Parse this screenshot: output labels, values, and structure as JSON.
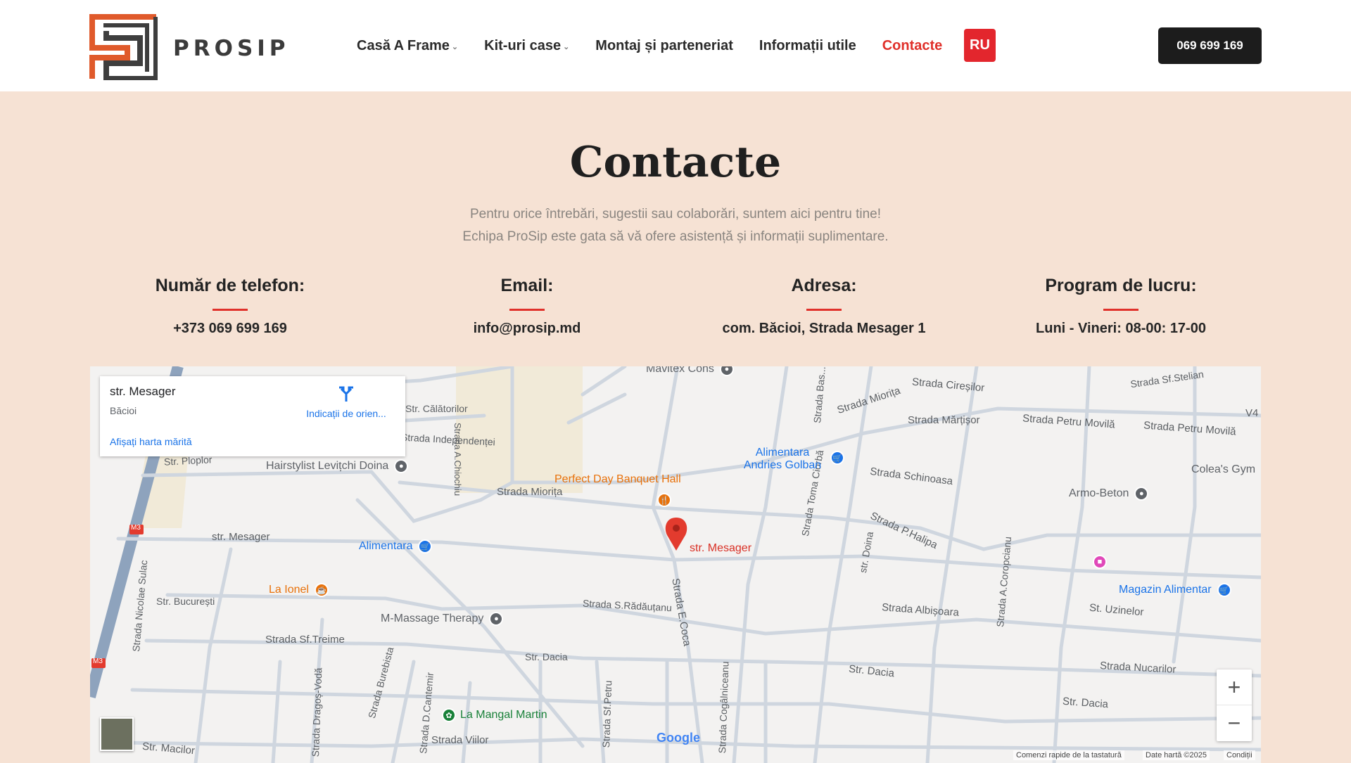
{
  "header": {
    "logo_text": "PROSIP",
    "nav": [
      {
        "label": "Casă A Frame",
        "dropdown": true
      },
      {
        "label": "Kit-uri case",
        "dropdown": true
      },
      {
        "label": "Montaj și parteneriat",
        "dropdown": false
      },
      {
        "label": "Informații utile",
        "dropdown": false
      },
      {
        "label": "Contacte",
        "dropdown": false,
        "active": true
      }
    ],
    "lang_button": "RU",
    "phone_button": "069 699 169"
  },
  "hero": {
    "title": "Contacte",
    "subtitle_line1": "Pentru orice întrebări, sugestii sau colaborări, suntem aici pentru tine!",
    "subtitle_line2": "Echipa ProSip este gata să vă ofere asistență și informații suplimentare."
  },
  "contacts": [
    {
      "heading": "Număr de telefon:",
      "value": "+373 069 699 169"
    },
    {
      "heading": "Email:",
      "value": "info@prosip.md"
    },
    {
      "heading": "Adresa:",
      "value": "com. Băcioi, Strada Mesager 1"
    },
    {
      "heading": "Program de lucru:",
      "value": "Luni - Vineri: 08-00: 17-00"
    }
  ],
  "map": {
    "card": {
      "title": "str. Mesager",
      "subtitle": "Băcioi",
      "directions": "Indicații de orien...",
      "larger_map": "Afișați harta mărită"
    },
    "pin_label": "str. Mesager",
    "streets": [
      "Str. Călătorilor",
      "Strada Independenței",
      "Str. Ploplor",
      "Strada A.Chiochiu",
      "Strada Miorița",
      "Strada Miorița",
      "Strada Cireșilor",
      "Strada Mărțișor",
      "Strada Petru Movilă",
      "Strada Petru Movilă",
      "Strada Schinoasa",
      "Strada P.Halipa",
      "str. Mesager",
      "Str. București",
      "Strada Sf.Treime",
      "Strada S.Rădăuțanu",
      "Strada E.Coca",
      "Str. Dacia",
      "Str. Dacia",
      "Str. Dacia",
      "Strada Albișoara",
      "St. Uzinelor",
      "Strada Nucarilor",
      "Str. Macilor",
      "Strada Viilor",
      "Strada Toma Ciorbă",
      "str. Doina",
      "Strada Nicolae Sulac",
      "Strada Dragoș-Vodă",
      "Strada Burebista",
      "Strada D.Cantemir",
      "Strada Sf.Petru",
      "Strada Cogâlniceanu",
      "Strada A.Coropcianu",
      "Strada Sf.Stelian",
      "Strada Bas..."
    ],
    "pois": [
      {
        "label": "Hairstylist Levițchi Doina",
        "color": "#5f6368",
        "icon": "pin-icon"
      },
      {
        "label": "Perfect Day Banquet Hall",
        "color": "#e8710a",
        "icon": "restaurant-icon"
      },
      {
        "label": "Alimentara Andries Golban",
        "color": "#1a73e8",
        "icon": "shop-icon"
      },
      {
        "label": "Alimentara",
        "color": "#1a73e8",
        "icon": "shop-icon"
      },
      {
        "label": "La Ionel",
        "color": "#e8710a",
        "icon": "cafe-icon"
      },
      {
        "label": "M-Massage Therapy",
        "color": "#5f6368",
        "icon": "pin-icon"
      },
      {
        "label": "La Mangal Martin",
        "color": "#188038",
        "icon": "leaf-icon"
      },
      {
        "label": "Armo-Beton",
        "color": "#5f6368",
        "icon": "pin-icon"
      },
      {
        "label": "Colea's Gym",
        "color": "#5f6368",
        "icon": "none"
      },
      {
        "label": "Magazin Alimentar",
        "color": "#1a73e8",
        "icon": "shop-icon"
      },
      {
        "label": "Mavitex Cons",
        "color": "#5f6368",
        "icon": "pin-icon"
      }
    ],
    "highway_labels": [
      "M3",
      "M3"
    ],
    "edge_label": "V4",
    "attribution": {
      "shortcuts": "Comenzi rapide de la tastatură",
      "data": "Date hartă ©2025",
      "terms": "Condiții"
    },
    "google_logo": "Google"
  },
  "colors": {
    "accent": "#e0302a",
    "background": "#f6e2d4",
    "dark_button": "#1c1c1c"
  }
}
